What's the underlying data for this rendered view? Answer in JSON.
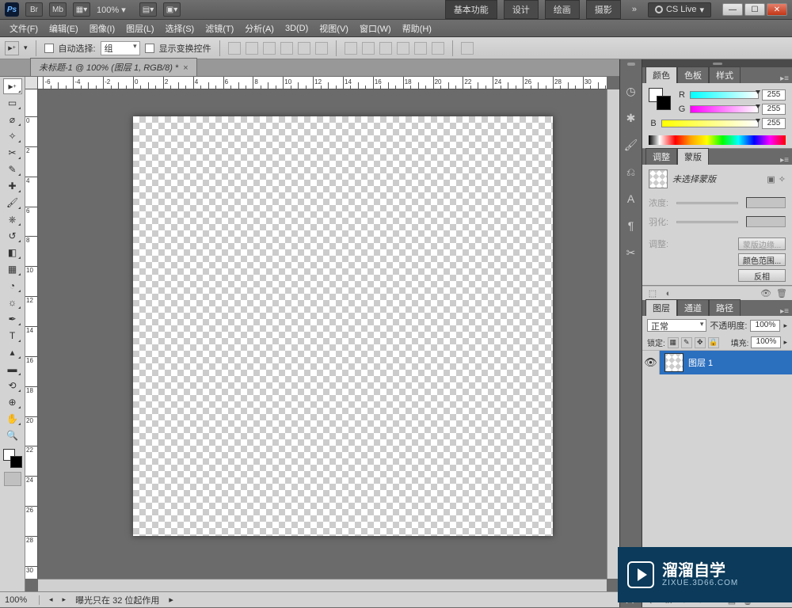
{
  "titlebar": {
    "app_short": "Ps",
    "br_icon": "Br",
    "mb_icon": "Mb",
    "zoom": "100%",
    "tabs": [
      "基本功能",
      "设计",
      "绘画",
      "摄影"
    ],
    "more": "»",
    "cslive": "CS Live"
  },
  "menu": [
    "文件(F)",
    "编辑(E)",
    "图像(I)",
    "图层(L)",
    "选择(S)",
    "滤镜(T)",
    "分析(A)",
    "3D(D)",
    "视图(V)",
    "窗口(W)",
    "帮助(H)"
  ],
  "options": {
    "auto_select": "自动选择:",
    "group": "组",
    "show_transform": "显示变换控件"
  },
  "doctab": "未标题-1 @ 100% (图层 1, RGB/8) *",
  "color_panel": {
    "tabs": [
      "颜色",
      "色板",
      "样式"
    ],
    "channels": [
      {
        "label": "R",
        "value": "255"
      },
      {
        "label": "G",
        "value": "255"
      },
      {
        "label": "B",
        "value": "255"
      }
    ]
  },
  "mask_panel": {
    "tabs": [
      "调整",
      "蒙版"
    ],
    "no_mask": "未选择蒙版",
    "density": "浓度:",
    "feather": "羽化:",
    "adjust": "调整:",
    "btn_edge": "蒙版边缘...",
    "btn_range": "颜色范围...",
    "btn_invert": "反相"
  },
  "layers_panel": {
    "tabs": [
      "图层",
      "通道",
      "路径"
    ],
    "blend": "正常",
    "opacity_label": "不透明度:",
    "opacity": "100%",
    "lock_label": "锁定:",
    "fill_label": "填充:",
    "fill": "100%",
    "layer_name": "图层 1"
  },
  "status": {
    "zoom": "100%",
    "msg": "曝光只在 32 位起作用"
  },
  "watermark": {
    "big": "溜溜自学",
    "small": "ZIXUE.3D66.COM"
  }
}
